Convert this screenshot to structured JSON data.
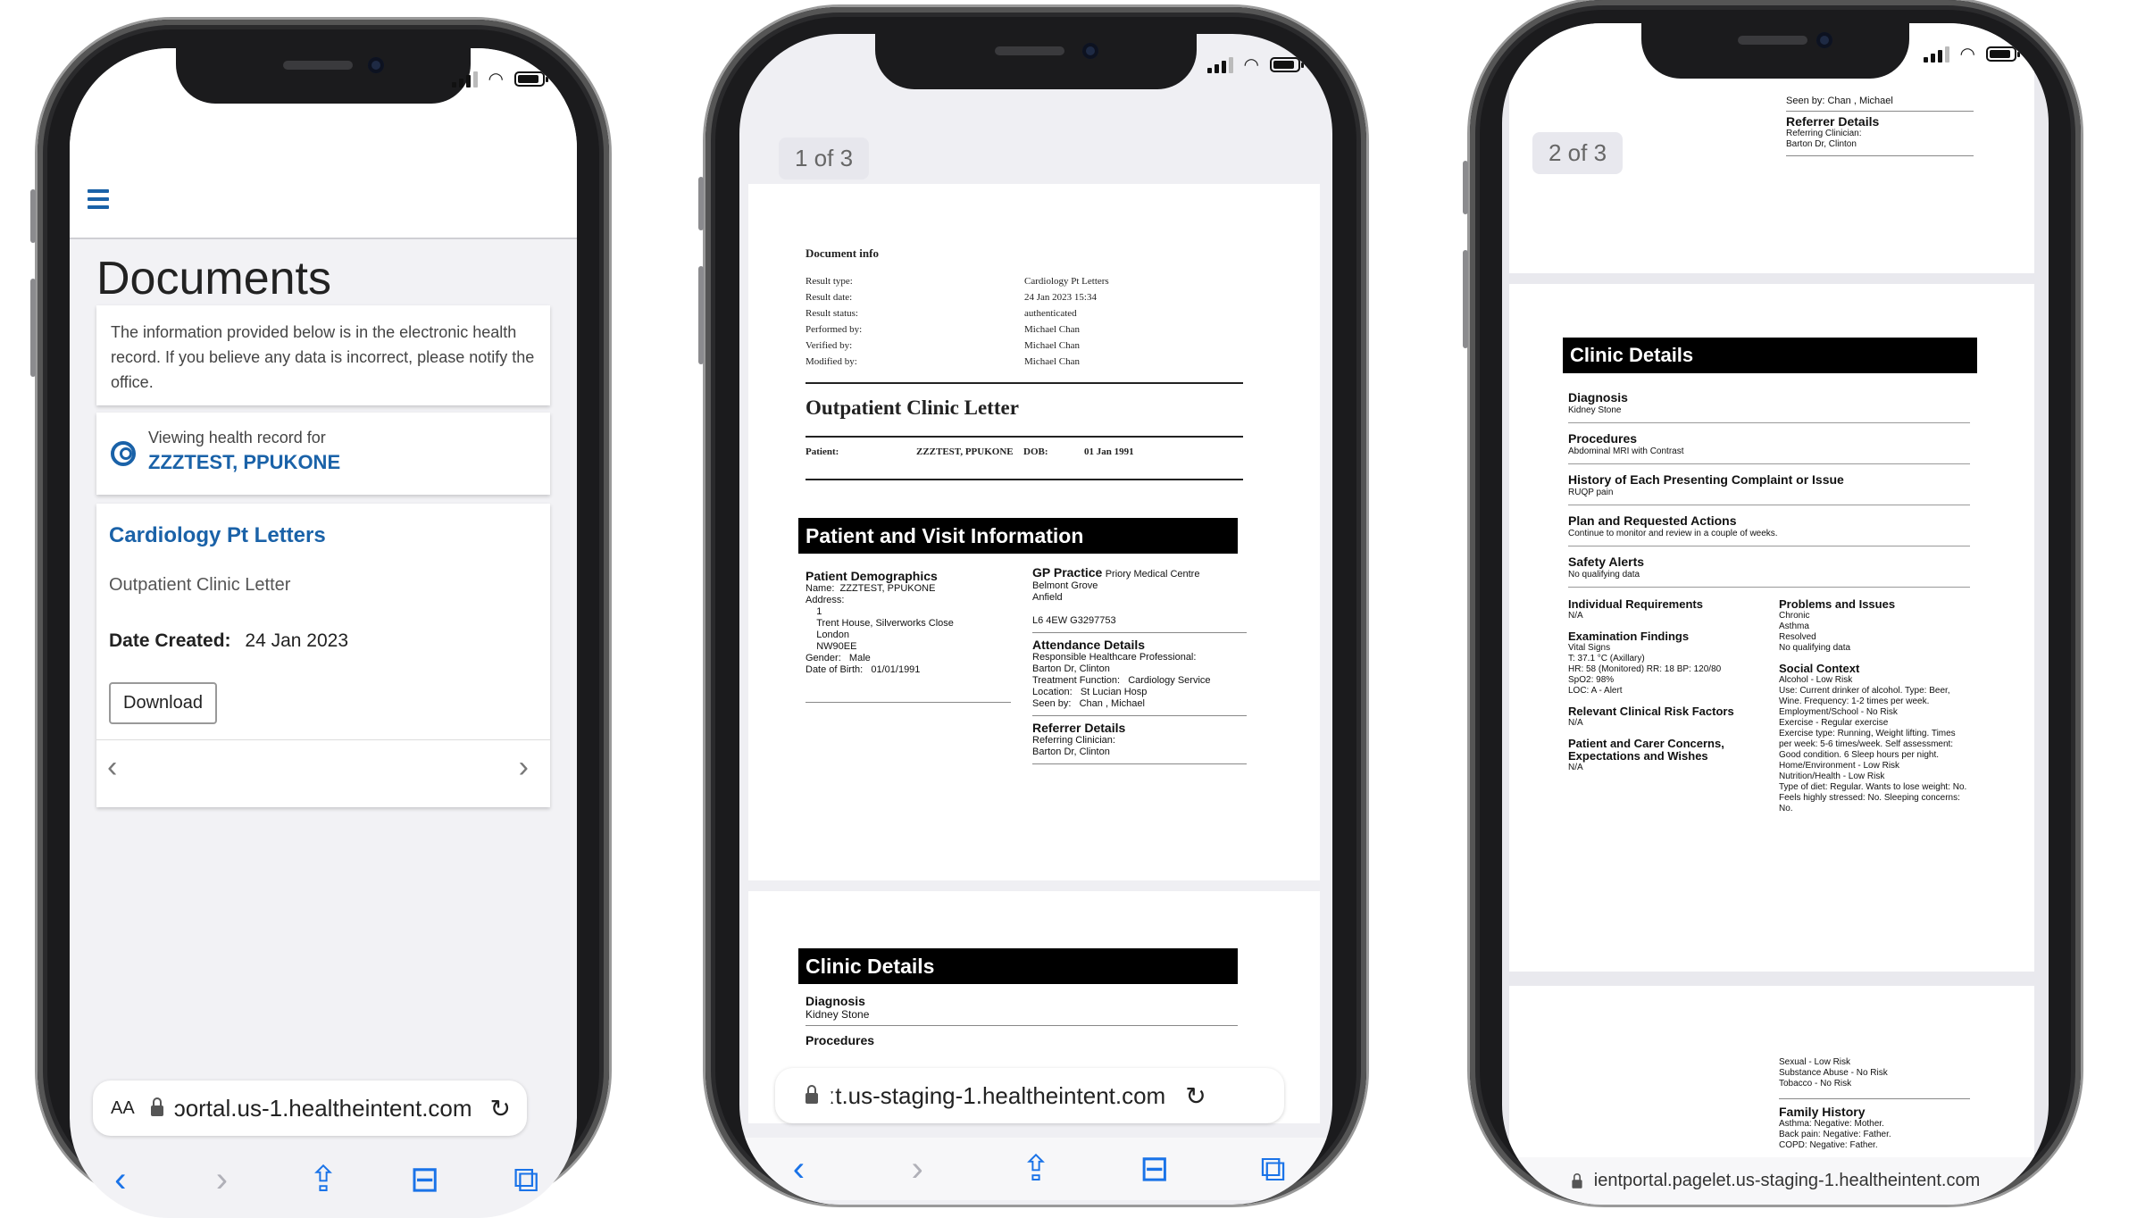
{
  "phone1": {
    "page_title": "Documents",
    "notice": "The information provided below is in the electronic health record. If you believe any data is incorrect, please notify the office.",
    "viewing_label": "Viewing health record for",
    "patient_name": "ZZZTEST, PPUKONE",
    "doc_link": "Cardiology Pt Letters",
    "doc_subtitle": "Outpatient Clinic Letter",
    "date_label": "Date Created:",
    "date_value": "24 Jan 2023",
    "download_label": "Download",
    "prev_glyph": "‹",
    "next_glyph": "›",
    "url_aa": "AA",
    "url_text": "ɔortal.us-1.healtheintent.com",
    "reload_glyph": "↻"
  },
  "phone2": {
    "page_counter": "1 of 3",
    "document_info": {
      "heading": "Document info",
      "rows": [
        {
          "k": "Result type:",
          "v": "Cardiology Pt Letters"
        },
        {
          "k": "Result date:",
          "v": "24 Jan 2023 15:34"
        },
        {
          "k": "Result status:",
          "v": "authenticated"
        },
        {
          "k": "Performed by:",
          "v": "Michael Chan"
        },
        {
          "k": "Verified by:",
          "v": "Michael Chan"
        },
        {
          "k": "Modified by:",
          "v": "Michael Chan"
        }
      ]
    },
    "letter_title": "Outpatient Clinic Letter",
    "patient_label": "Patient:",
    "patient_value": "ZZZTEST, PPUKONE",
    "dob_label": "DOB:",
    "dob_value": "01 Jan 1991",
    "section1": "Patient and Visit Information",
    "demographics_heading": "Patient Demographics",
    "demographics_lines": [
      "Name:  ZZZTEST, PPUKONE",
      "Address:",
      "    1",
      "    Trent House, Silverworks Close",
      "    London",
      "    NW90EE",
      "Gender:   Male",
      "Date of Birth:   01/01/1991"
    ],
    "gp_heading": "GP Practice",
    "gp_name": "Priory Medical Centre",
    "gp_lines": [
      "Belmont Grove",
      "Anfield",
      "",
      "L6 4EW G3297753"
    ],
    "attendance_heading": "Attendance Details",
    "attendance_lines": [
      "Responsible Healthcare Professional:",
      "Barton Dr, Clinton",
      "Treatment Function:   Cardiology Service",
      "Location:   St Lucian Hosp",
      "Seen by:   Chan , Michael"
    ],
    "referrer_heading": "Referrer Details",
    "referrer_lines": [
      "Referring Clinician:",
      "Barton Dr, Clinton"
    ],
    "section2": "Clinic Details",
    "diagnosis_heading": "Diagnosis",
    "diagnosis_value": "Kidney Stone",
    "procedures_cut": "Procedures",
    "url_text": "ːt.us-staging-1.healtheintent.com",
    "reload_glyph": "↻"
  },
  "phone3": {
    "page_counter": "2 of 3",
    "seen_by": "Seen by:   Chan , Michael",
    "referrer_heading": "Referrer Details",
    "referrer_lines": [
      "Referring Clinician:",
      "Barton Dr, Clinton"
    ],
    "section": "Clinic Details",
    "items": [
      {
        "h": "Diagnosis",
        "v": "Kidney Stone"
      },
      {
        "h": "Procedures",
        "v": "Abdominal MRI with Contrast"
      },
      {
        "h": "History of Each Presenting Complaint or Issue",
        "v": "RUQP pain"
      },
      {
        "h": "Plan and Requested Actions",
        "v": "Continue to monitor and review in a couple of weeks."
      },
      {
        "h": "Safety Alerts",
        "v": "No qualifying data"
      }
    ],
    "left_col": [
      {
        "h": "Individual Requirements",
        "lines": [
          "N/A"
        ]
      },
      {
        "h": "Examination Findings",
        "lines": [
          "Vital Signs",
          "T: 37.1 °C  (Axillary)",
          "HR: 58 (Monitored)  RR: 18  BP: 120/80",
          "SpO2: 98%",
          "LOC: A - Alert"
        ]
      },
      {
        "h": "Relevant Clinical Risk Factors",
        "lines": [
          "N/A"
        ]
      },
      {
        "h": "Patient and Carer Concerns, Expectations and Wishes",
        "lines": [
          "N/A"
        ]
      }
    ],
    "right_col": [
      {
        "h": "Problems and Issues",
        "lines": [
          "Chronic",
          "Asthma",
          "Resolved",
          "No qualifying data"
        ]
      },
      {
        "h": "Social Context",
        "lines": [
          "Alcohol - Low Risk",
          "Use: Current drinker of alcohol. Type: Beer, Wine. Frequency: 1-2 times per week.",
          "Employment/School - No Risk",
          "Exercise - Regular exercise",
          "Exercise type: Running, Weight lifting. Times per week: 5-6 times/week. Self assessment: Good condition. 6 Sleep hours per night.",
          "Home/Environment - Low Risk",
          "Nutrition/Health - Low Risk",
          "Type of diet: Regular. Wants to lose weight: No. Feels highly stressed: No. Sleeping concerns: No."
        ]
      }
    ],
    "page3_lines": [
      "Sexual - Low Risk",
      "Substance Abuse - No Risk",
      "Tobacco - No Risk"
    ],
    "family_heading": "Family History",
    "family_lines": [
      "Asthma: Negative: Mother.",
      "Back pain: Negative: Father.",
      "COPD: Negative: Father."
    ],
    "url_text": "ientportal.pagelet.us-staging-1.healtheintent.com"
  },
  "icons": {
    "back": "‹",
    "forward": "›",
    "share": "⇪",
    "bookmarks": "⊟",
    "tabs": "⧉"
  },
  "colors": {
    "accent": "#1a62a8",
    "safari_blue": "#1a73e8",
    "band": "#000000"
  }
}
